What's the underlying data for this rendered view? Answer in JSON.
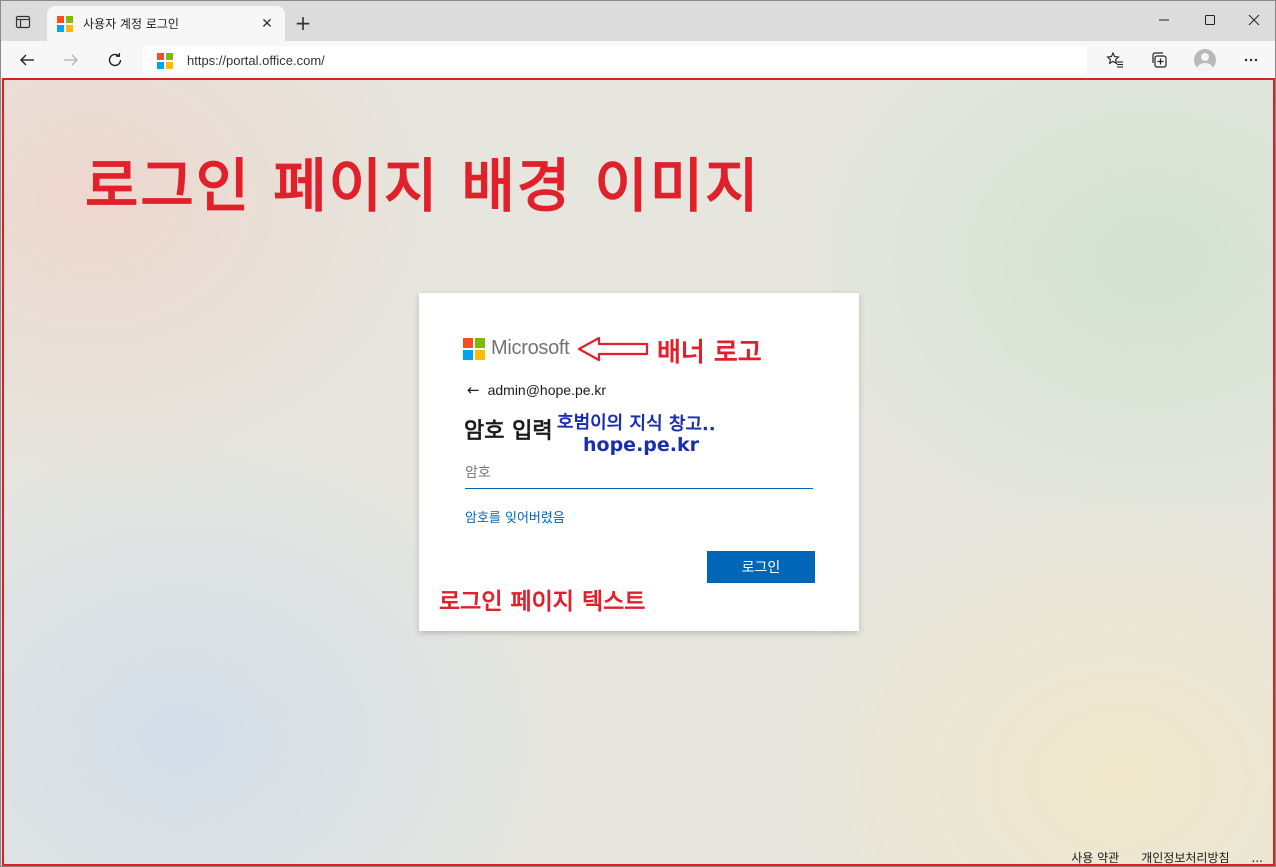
{
  "browser": {
    "tab_title": "사용자 계정 로그인",
    "url": "https://portal.office.com/"
  },
  "login": {
    "brand": "Microsoft",
    "identity": "admin@hope.pe.kr",
    "heading": "암호 입력",
    "password_placeholder": "암호",
    "password_value": "",
    "forgot_link": "암호를 잊어버렸음",
    "signin_button": "로그인"
  },
  "annotations": {
    "background_label": "로그인 페이지 배경 이미지",
    "banner_label": "배너 로고",
    "text_label": "로그인 페이지 텍스트"
  },
  "watermark": {
    "line1": "호범이의 지식 창고..",
    "line2": "hope.pe.kr"
  },
  "footer": {
    "terms": "사용 약관",
    "privacy": "개인정보처리방침",
    "more": "..."
  },
  "colors": {
    "accent": "#0067b8",
    "annotation_red": "#e0202a",
    "watermark_blue": "#1a2fb0",
    "ms_red": "#f25022",
    "ms_green": "#7fba00",
    "ms_blue": "#00a4ef",
    "ms_yellow": "#ffb900"
  }
}
